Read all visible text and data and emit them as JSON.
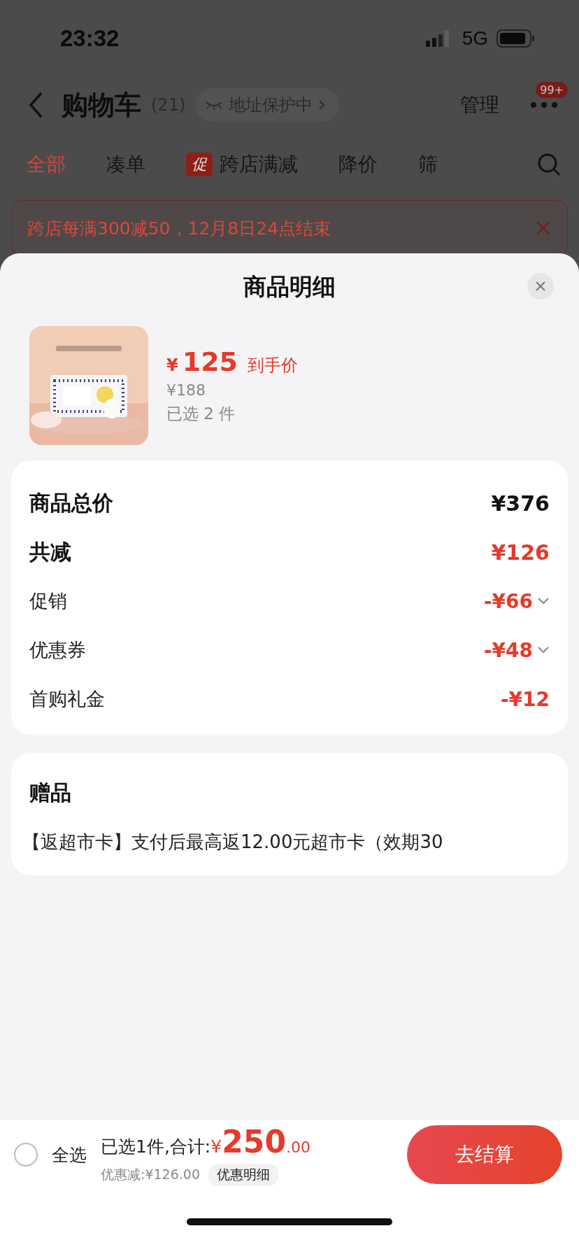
{
  "status_bar": {
    "time": "23:32",
    "network": "5G"
  },
  "nav": {
    "title": "购物车",
    "count": "(21)",
    "address_chip": "地址保护中",
    "manage": "管理",
    "badge": "99+"
  },
  "tabs": [
    {
      "label": "全部",
      "selected": true,
      "kind": "plain"
    },
    {
      "label": "凑单",
      "selected": false,
      "kind": "plain"
    },
    {
      "label": "跨店满减",
      "selected": false,
      "kind": "promo",
      "tag": "促"
    },
    {
      "label": "降价",
      "selected": false,
      "kind": "plain"
    },
    {
      "label": "筛",
      "selected": false,
      "kind": "plain"
    }
  ],
  "banner": {
    "text": "跨店每满300减50，12月8日24点结束"
  },
  "sheet": {
    "title": "商品明细",
    "product": {
      "kind": "picture",
      "price": "125",
      "currency": "¥",
      "price_label": "到手价",
      "original_price": "¥188",
      "selected_count": "已选 2 件"
    },
    "price_rows": [
      {
        "label": "商品总价",
        "value": "¥376",
        "kind": "total",
        "expandable": false
      },
      {
        "label": "共减",
        "value": "¥126",
        "kind": "reduction",
        "expandable": false
      },
      {
        "label": "促销",
        "value": "-¥66",
        "kind": "item",
        "expandable": true
      },
      {
        "label": "优惠券",
        "value": "-¥48",
        "kind": "item",
        "expandable": true
      },
      {
        "label": "首购礼金",
        "value": "-¥12",
        "kind": "item",
        "expandable": false
      }
    ],
    "gift": {
      "title": "赠品",
      "text": "【返超市卡】支付后最高返12.00元超市卡（效期30"
    }
  },
  "footer": {
    "select_all": {
      "label": "全选",
      "checked": false
    },
    "summary": "已选1件,合计:",
    "currency": "¥",
    "total_int": "250",
    "total_dec": ".00",
    "discount": "优惠减:¥126.00",
    "discount_detail": "优惠明细",
    "checkout": "去结算"
  }
}
